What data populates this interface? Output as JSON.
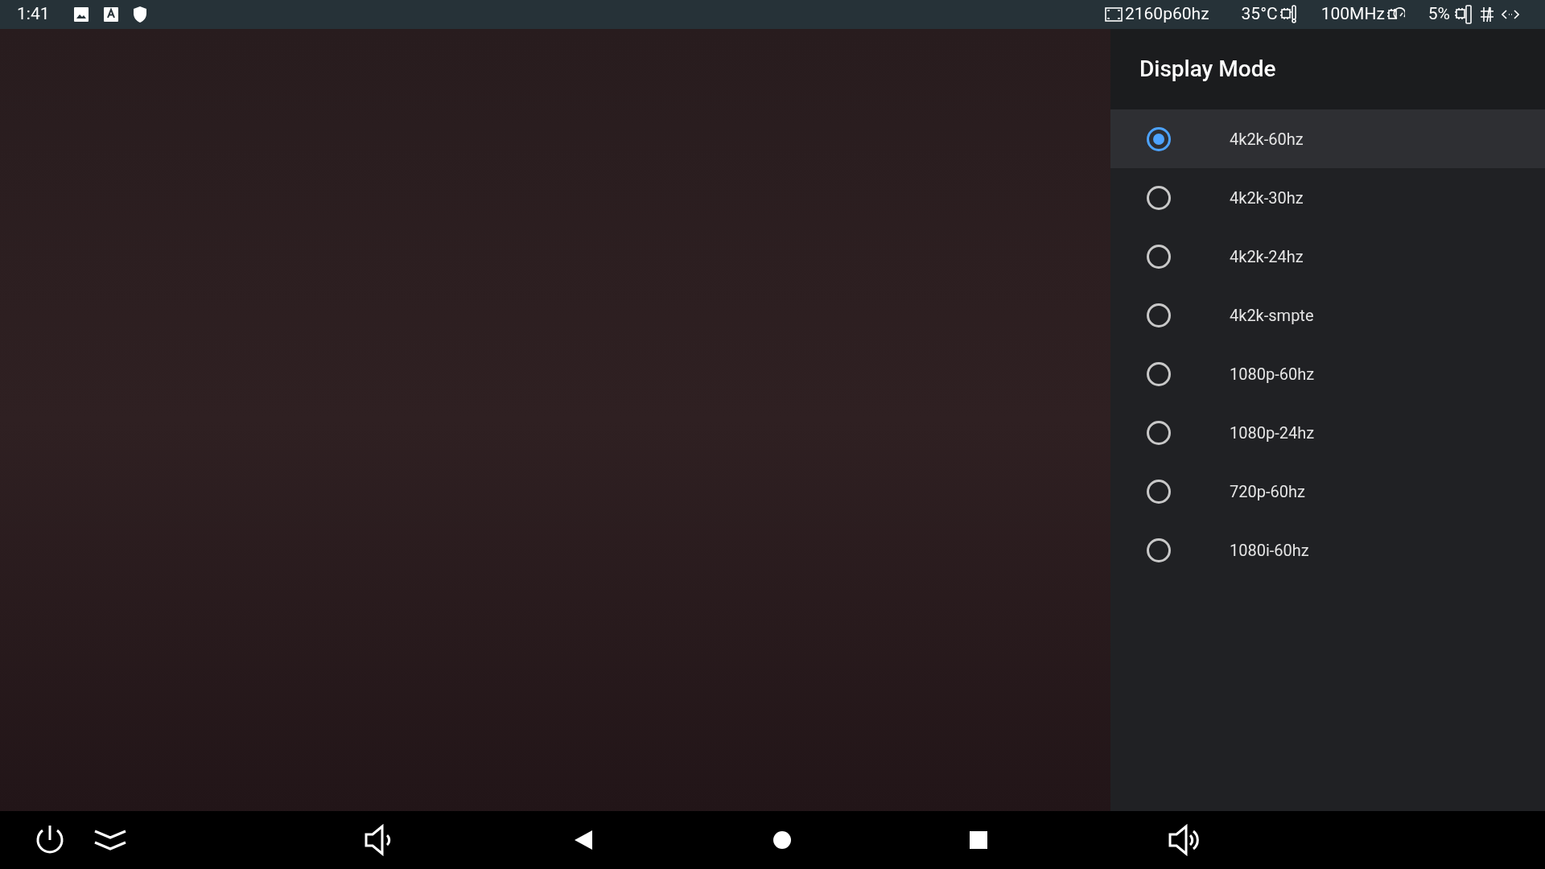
{
  "status_bar": {
    "time": "1:41",
    "resolution": "2160p60hz",
    "temperature": "35°C",
    "cpu_frequency": "100MHz",
    "cpu_load": "5%"
  },
  "panel": {
    "title": "Display Mode",
    "options": [
      {
        "label": "4k2k-60hz",
        "selected": true
      },
      {
        "label": "4k2k-30hz",
        "selected": false
      },
      {
        "label": "4k2k-24hz",
        "selected": false
      },
      {
        "label": "4k2k-smpte",
        "selected": false
      },
      {
        "label": "1080p-60hz",
        "selected": false
      },
      {
        "label": "1080p-24hz",
        "selected": false
      },
      {
        "label": "720p-60hz",
        "selected": false
      },
      {
        "label": "1080i-60hz",
        "selected": false
      }
    ]
  }
}
